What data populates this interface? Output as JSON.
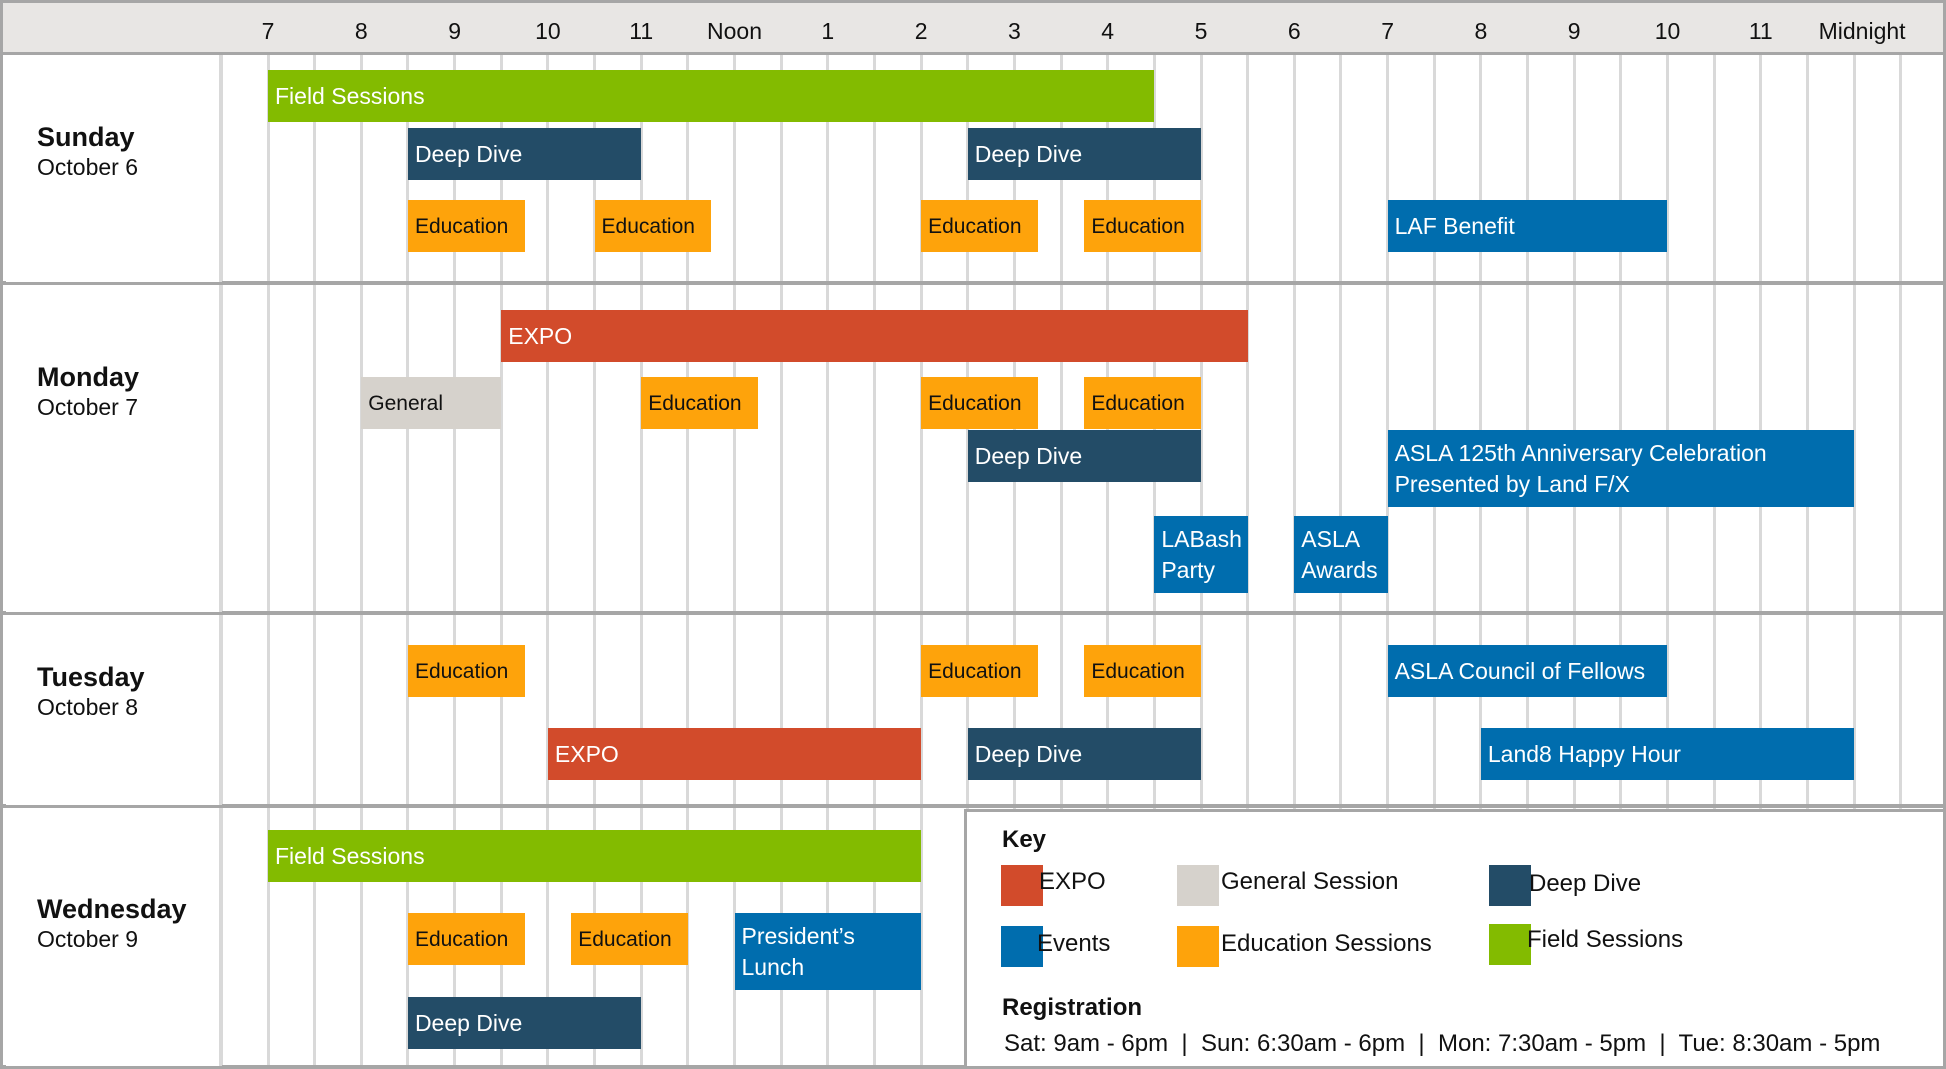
{
  "chart_data": {
    "type": "gantt",
    "title": "",
    "x_axis": {
      "unit": "hour",
      "range": [
        6.5,
        24.5
      ],
      "tick_values": [
        7,
        8,
        9,
        10,
        11,
        12,
        13,
        14,
        15,
        16,
        17,
        18,
        19,
        20,
        21,
        22,
        23,
        24
      ],
      "tick_labels": [
        "7",
        "8",
        "9",
        "10",
        "11",
        "Noon",
        "1",
        "2",
        "3",
        "4",
        "5",
        "6",
        "7",
        "8",
        "9",
        "10",
        "11",
        "Midnight"
      ],
      "gridlines": "every half hour"
    },
    "categories": {
      "expo": {
        "label": "EXPO",
        "color": "#d24b2b"
      },
      "general": {
        "label": "General Session",
        "color": "#d6d2cc"
      },
      "deepdive": {
        "label": "Deep Dive",
        "color": "#234c67"
      },
      "events": {
        "label": "Events",
        "color": "#006dae"
      },
      "education": {
        "label": "Education Sessions",
        "color": "#fea30b"
      },
      "field": {
        "label": "Field Sessions",
        "color": "#83bb00"
      }
    },
    "days": [
      {
        "day": "Sunday",
        "date": "October 6",
        "events": [
          {
            "label": "Field Sessions",
            "category": "field",
            "start": 7.0,
            "end": 16.5,
            "lane": 0
          },
          {
            "label": "Deep Dive",
            "category": "deepdive",
            "start": 8.5,
            "end": 11.0,
            "lane": 1
          },
          {
            "label": "Deep Dive",
            "category": "deepdive",
            "start": 14.5,
            "end": 17.0,
            "lane": 1
          },
          {
            "label": "Education",
            "category": "education",
            "start": 8.5,
            "end": 9.75,
            "lane": 2
          },
          {
            "label": "Education",
            "category": "education",
            "start": 10.5,
            "end": 11.75,
            "lane": 2
          },
          {
            "label": "Education",
            "category": "education",
            "start": 14.0,
            "end": 15.25,
            "lane": 2
          },
          {
            "label": "Education",
            "category": "education",
            "start": 15.75,
            "end": 17.0,
            "lane": 2
          },
          {
            "label": "LAF Benefit",
            "category": "events",
            "start": 19.0,
            "end": 22.0,
            "lane": 2
          }
        ]
      },
      {
        "day": "Monday",
        "date": "October 7",
        "events": [
          {
            "label": "EXPO",
            "category": "expo",
            "start": 9.5,
            "end": 17.5,
            "lane": 0
          },
          {
            "label": "General",
            "category": "general",
            "start": 8.0,
            "end": 9.5,
            "lane": 1
          },
          {
            "label": "Education",
            "category": "education",
            "start": 11.0,
            "end": 12.25,
            "lane": 1
          },
          {
            "label": "Education",
            "category": "education",
            "start": 14.0,
            "end": 15.25,
            "lane": 1
          },
          {
            "label": "Education",
            "category": "education",
            "start": 15.75,
            "end": 17.0,
            "lane": 1
          },
          {
            "label": "Deep Dive",
            "category": "deepdive",
            "start": 14.5,
            "end": 17.0,
            "lane": 2
          },
          {
            "label": "ASLA 125th Anniversary Celebration\nPresented by Land F/X",
            "category": "events",
            "start": 19.0,
            "end": 24.0,
            "lane": 2
          },
          {
            "label": "LABash\nParty",
            "category": "events",
            "start": 16.5,
            "end": 17.5,
            "lane": 3
          },
          {
            "label": "ASLA\nAwards",
            "category": "events",
            "start": 18.0,
            "end": 19.0,
            "lane": 3
          }
        ]
      },
      {
        "day": "Tuesday",
        "date": "October 8",
        "events": [
          {
            "label": "Education",
            "category": "education",
            "start": 8.5,
            "end": 9.75,
            "lane": 0
          },
          {
            "label": "Education",
            "category": "education",
            "start": 14.0,
            "end": 15.25,
            "lane": 0
          },
          {
            "label": "Education",
            "category": "education",
            "start": 15.75,
            "end": 17.0,
            "lane": 0
          },
          {
            "label": "ASLA Council of Fellows",
            "category": "events",
            "start": 19.0,
            "end": 22.0,
            "lane": 0
          },
          {
            "label": "EXPO",
            "category": "expo",
            "start": 10.0,
            "end": 14.0,
            "lane": 1
          },
          {
            "label": "Deep Dive",
            "category": "deepdive",
            "start": 14.5,
            "end": 17.0,
            "lane": 1
          },
          {
            "label": "Land8 Happy Hour",
            "category": "events",
            "start": 20.0,
            "end": 24.0,
            "lane": 1
          }
        ]
      },
      {
        "day": "Wednesday",
        "date": "October 9",
        "events": [
          {
            "label": "Field Sessions",
            "category": "field",
            "start": 7.0,
            "end": 14.0,
            "lane": 0
          },
          {
            "label": "Education",
            "category": "education",
            "start": 8.5,
            "end": 9.75,
            "lane": 1
          },
          {
            "label": "Education",
            "category": "education",
            "start": 10.25,
            "end": 11.5,
            "lane": 1
          },
          {
            "label": "President’s\nLunch",
            "category": "events",
            "start": 12.0,
            "end": 14.0,
            "lane": 1
          },
          {
            "label": "Deep Dive",
            "category": "deepdive",
            "start": 8.5,
            "end": 11.0,
            "lane": 2
          }
        ]
      }
    ],
    "legend": {
      "title": "Key",
      "placement": "bottom-right",
      "items": [
        "EXPO",
        "General Session",
        "Deep Dive",
        "Events",
        "Education Sessions",
        "Field Sessions"
      ]
    }
  },
  "key": {
    "title": "Key",
    "items": [
      {
        "label": "EXPO",
        "category": "expo"
      },
      {
        "label": "General Session",
        "category": "general"
      },
      {
        "label": "Deep Dive",
        "category": "deepdive"
      },
      {
        "label": "Events",
        "category": "events"
      },
      {
        "label": "Education Sessions",
        "category": "education"
      },
      {
        "label": "Field Sessions",
        "category": "field"
      }
    ],
    "registration_title": "Registration",
    "registration_hours": "Sat: 9am - 6pm  |  Sun: 6:30am - 6pm  |  Mon: 7:30am - 5pm  |  Tue: 8:30am - 5pm"
  }
}
